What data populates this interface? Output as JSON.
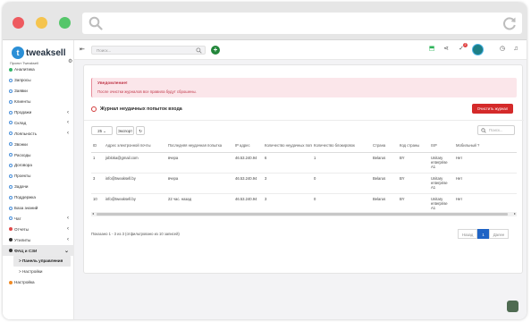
{
  "brand": {
    "name": "tweaksell",
    "project": "Проект Tweaksell"
  },
  "search": {
    "placeholder": "Поиск..."
  },
  "header": {
    "notif_count": "2"
  },
  "nav": [
    {
      "label": "Аналитика",
      "kind": "green"
    },
    {
      "label": "Запросы",
      "kind": "blue"
    },
    {
      "label": "Заявки",
      "kind": "blue"
    },
    {
      "label": "Клиенты",
      "kind": "blue"
    },
    {
      "label": "Продажи",
      "kind": "blue",
      "chev": "‹"
    },
    {
      "label": "Склад",
      "kind": "blue",
      "chev": "‹"
    },
    {
      "label": "Лояльность",
      "kind": "blue",
      "chev": "‹"
    },
    {
      "label": "Звонки",
      "kind": "blue"
    },
    {
      "label": "Расходы",
      "kind": "blue"
    },
    {
      "label": "Договора",
      "kind": "blue"
    },
    {
      "label": "Проекты",
      "kind": "blue"
    },
    {
      "label": "Задачи",
      "kind": "blue"
    },
    {
      "label": "Поддержка",
      "kind": "blue"
    },
    {
      "label": "База знаний",
      "kind": "blue"
    },
    {
      "label": "Чат",
      "kind": "blue",
      "chev": "‹"
    },
    {
      "label": "Отчеты",
      "kind": "red",
      "chev": "‹"
    },
    {
      "label": "Утилиты",
      "kind": "dark",
      "chev": "‹"
    },
    {
      "label": "ФАЦ и СЗИ",
      "kind": "dark",
      "chev": "⌄",
      "open": true
    }
  ],
  "nav_sub": [
    {
      "label": "> Панель управления",
      "active": true
    },
    {
      "label": "> Настройки",
      "active": false
    }
  ],
  "nav_bottom": {
    "label": "Настройка"
  },
  "alert": {
    "title": "Уведомление!",
    "message": "После очистки журналов все правила будут сброшены."
  },
  "section": {
    "title": "Журнал неудачных попыток входа",
    "clear_button": "Очистить журнал"
  },
  "table_controls": {
    "page_size": "25",
    "export": "Экспорт",
    "search_placeholder": "Поиск..."
  },
  "table": {
    "columns": [
      "ID",
      "Адрес электронной почты",
      "Последняя неудачная попытка",
      "IP адрес",
      "Количество неудачных попыток",
      "Количество блокировок",
      "Страна",
      "Код страны",
      "ISP",
      "Мобильный ?"
    ],
    "rows": [
      [
        "1",
        "jobloka@gmail.com",
        "вчера",
        "46.53.240.94",
        "6",
        "1",
        "Belarus",
        "BY",
        "Unitary enterprise A1",
        "Нет"
      ],
      [
        "3",
        "info@tweaksell.by",
        "вчера",
        "46.53.240.94",
        "3",
        "0",
        "Belarus",
        "BY",
        "Unitary enterprise A1",
        "Нет"
      ],
      [
        "10",
        "info@tweaksell.by",
        "22 час. назад",
        "46.53.240.94",
        "3",
        "0",
        "Belarus",
        "BY",
        "Unitary enterprise A1",
        "Нет"
      ]
    ]
  },
  "table_info": "Показано 1 - 3 из 3 (отфильтровано из 10 записей)",
  "pager": {
    "prev": "Назад",
    "current": "1",
    "next": "Далее"
  }
}
